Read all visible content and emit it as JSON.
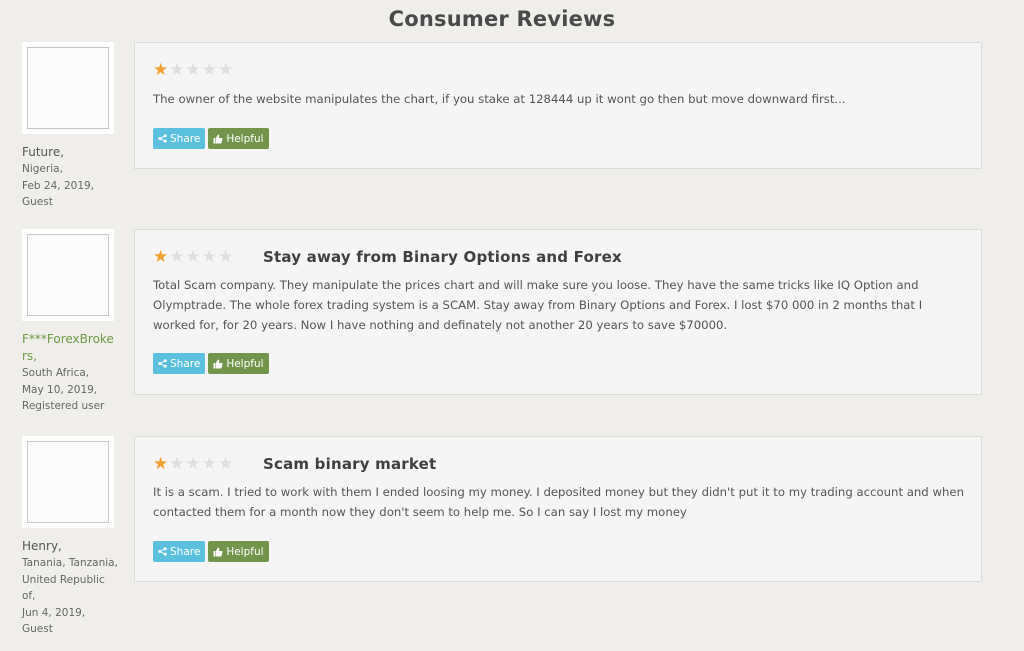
{
  "page": {
    "title": "Consumer Reviews"
  },
  "reviews": [
    {
      "author": "Future,",
      "country": "Nigeria,",
      "date": "Feb 24, 2019,",
      "role": "Guest",
      "rating": 1,
      "max_rating": 5,
      "title": "",
      "text": "The owner of the website manipulates the chart, if you stake at 128444 up it wont go then but move downward first...",
      "share_label": "Share",
      "helpful_label": "Helpful"
    },
    {
      "author": "F***ForexBrokers,",
      "country": "South Africa,",
      "date": "May 10, 2019,",
      "role": "Registered user",
      "rating": 1,
      "max_rating": 5,
      "title": "Stay away from Binary Options and Forex",
      "text": "Total Scam company. They manipulate the prices chart and will make sure you loose. They have the same tricks like IQ Option and Olymptrade. The whole forex trading system is a SCAM. Stay away from Binary Options and Forex. I lost $70 000 in 2 months that I worked for, for 20 years. Now I have nothing and definately not another 20 years to save $70000.",
      "share_label": "Share",
      "helpful_label": "Helpful"
    },
    {
      "author": "Henry,",
      "country": "Tanania, Tanzania, United Republic of,",
      "date": "Jun 4, 2019,",
      "role": "Guest",
      "rating": 1,
      "max_rating": 5,
      "title": "Scam binary market",
      "text": "It is a scam. I tried to work with them I ended loosing my money. I deposited money but they didn't put it to my trading account and when contacted them for a month now they don't seem to help me. So I can say I lost my money",
      "share_label": "Share",
      "helpful_label": "Helpful"
    }
  ],
  "colors": {
    "star_on": "#f0a030",
    "star_off": "#dedede",
    "share": "#5bc0de",
    "helpful": "#73954b",
    "author_link": "#6e9a46"
  }
}
